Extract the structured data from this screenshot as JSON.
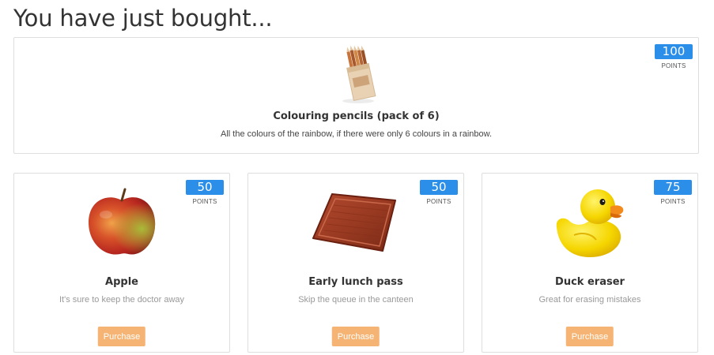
{
  "page": {
    "title": "You have just bought..."
  },
  "featured": {
    "name": "Colouring pencils (pack of 6)",
    "description": "All the colours of the rainbow, if there were only 6 colours in a rainbow.",
    "points": "100",
    "points_label": "POINTS",
    "image": "colouring-pencils-image"
  },
  "items": [
    {
      "name": "Apple",
      "description": "It's sure to keep the doctor away",
      "points": "50",
      "points_label": "POINTS",
      "button": "Purchase",
      "image": "apple-image"
    },
    {
      "name": "Early lunch pass",
      "description": "Skip the queue in the canteen",
      "points": "50",
      "points_label": "POINTS",
      "button": "Purchase",
      "image": "lunch-tray-image"
    },
    {
      "name": "Duck eraser",
      "description": "Great for erasing mistakes",
      "points": "75",
      "points_label": "POINTS",
      "button": "Purchase",
      "image": "rubber-duck-image"
    }
  ],
  "colors": {
    "points_badge": "#2b8ee8",
    "purchase_button": "#f5b473"
  }
}
